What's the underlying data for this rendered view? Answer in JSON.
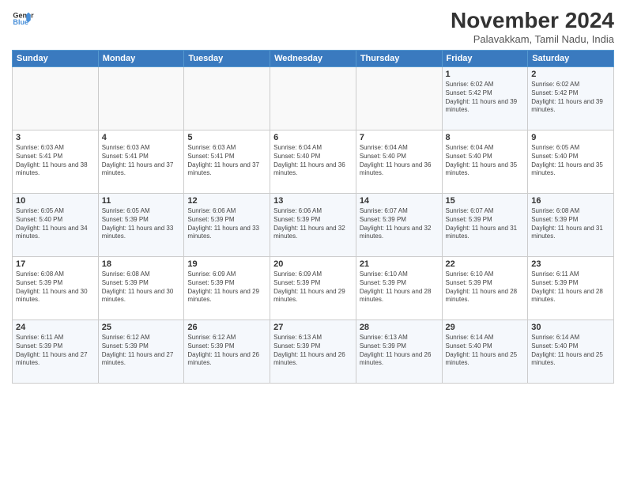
{
  "logo": {
    "line1": "General",
    "line2": "Blue"
  },
  "title": "November 2024",
  "subtitle": "Palavakkam, Tamil Nadu, India",
  "days_header": [
    "Sunday",
    "Monday",
    "Tuesday",
    "Wednesday",
    "Thursday",
    "Friday",
    "Saturday"
  ],
  "weeks": [
    [
      {
        "num": "",
        "info": ""
      },
      {
        "num": "",
        "info": ""
      },
      {
        "num": "",
        "info": ""
      },
      {
        "num": "",
        "info": ""
      },
      {
        "num": "",
        "info": ""
      },
      {
        "num": "1",
        "info": "Sunrise: 6:02 AM\nSunset: 5:42 PM\nDaylight: 11 hours and 39 minutes."
      },
      {
        "num": "2",
        "info": "Sunrise: 6:02 AM\nSunset: 5:42 PM\nDaylight: 11 hours and 39 minutes."
      }
    ],
    [
      {
        "num": "3",
        "info": "Sunrise: 6:03 AM\nSunset: 5:41 PM\nDaylight: 11 hours and 38 minutes."
      },
      {
        "num": "4",
        "info": "Sunrise: 6:03 AM\nSunset: 5:41 PM\nDaylight: 11 hours and 37 minutes."
      },
      {
        "num": "5",
        "info": "Sunrise: 6:03 AM\nSunset: 5:41 PM\nDaylight: 11 hours and 37 minutes."
      },
      {
        "num": "6",
        "info": "Sunrise: 6:04 AM\nSunset: 5:40 PM\nDaylight: 11 hours and 36 minutes."
      },
      {
        "num": "7",
        "info": "Sunrise: 6:04 AM\nSunset: 5:40 PM\nDaylight: 11 hours and 36 minutes."
      },
      {
        "num": "8",
        "info": "Sunrise: 6:04 AM\nSunset: 5:40 PM\nDaylight: 11 hours and 35 minutes."
      },
      {
        "num": "9",
        "info": "Sunrise: 6:05 AM\nSunset: 5:40 PM\nDaylight: 11 hours and 35 minutes."
      }
    ],
    [
      {
        "num": "10",
        "info": "Sunrise: 6:05 AM\nSunset: 5:40 PM\nDaylight: 11 hours and 34 minutes."
      },
      {
        "num": "11",
        "info": "Sunrise: 6:05 AM\nSunset: 5:39 PM\nDaylight: 11 hours and 33 minutes."
      },
      {
        "num": "12",
        "info": "Sunrise: 6:06 AM\nSunset: 5:39 PM\nDaylight: 11 hours and 33 minutes."
      },
      {
        "num": "13",
        "info": "Sunrise: 6:06 AM\nSunset: 5:39 PM\nDaylight: 11 hours and 32 minutes."
      },
      {
        "num": "14",
        "info": "Sunrise: 6:07 AM\nSunset: 5:39 PM\nDaylight: 11 hours and 32 minutes."
      },
      {
        "num": "15",
        "info": "Sunrise: 6:07 AM\nSunset: 5:39 PM\nDaylight: 11 hours and 31 minutes."
      },
      {
        "num": "16",
        "info": "Sunrise: 6:08 AM\nSunset: 5:39 PM\nDaylight: 11 hours and 31 minutes."
      }
    ],
    [
      {
        "num": "17",
        "info": "Sunrise: 6:08 AM\nSunset: 5:39 PM\nDaylight: 11 hours and 30 minutes."
      },
      {
        "num": "18",
        "info": "Sunrise: 6:08 AM\nSunset: 5:39 PM\nDaylight: 11 hours and 30 minutes."
      },
      {
        "num": "19",
        "info": "Sunrise: 6:09 AM\nSunset: 5:39 PM\nDaylight: 11 hours and 29 minutes."
      },
      {
        "num": "20",
        "info": "Sunrise: 6:09 AM\nSunset: 5:39 PM\nDaylight: 11 hours and 29 minutes."
      },
      {
        "num": "21",
        "info": "Sunrise: 6:10 AM\nSunset: 5:39 PM\nDaylight: 11 hours and 28 minutes."
      },
      {
        "num": "22",
        "info": "Sunrise: 6:10 AM\nSunset: 5:39 PM\nDaylight: 11 hours and 28 minutes."
      },
      {
        "num": "23",
        "info": "Sunrise: 6:11 AM\nSunset: 5:39 PM\nDaylight: 11 hours and 28 minutes."
      }
    ],
    [
      {
        "num": "24",
        "info": "Sunrise: 6:11 AM\nSunset: 5:39 PM\nDaylight: 11 hours and 27 minutes."
      },
      {
        "num": "25",
        "info": "Sunrise: 6:12 AM\nSunset: 5:39 PM\nDaylight: 11 hours and 27 minutes."
      },
      {
        "num": "26",
        "info": "Sunrise: 6:12 AM\nSunset: 5:39 PM\nDaylight: 11 hours and 26 minutes."
      },
      {
        "num": "27",
        "info": "Sunrise: 6:13 AM\nSunset: 5:39 PM\nDaylight: 11 hours and 26 minutes."
      },
      {
        "num": "28",
        "info": "Sunrise: 6:13 AM\nSunset: 5:39 PM\nDaylight: 11 hours and 26 minutes."
      },
      {
        "num": "29",
        "info": "Sunrise: 6:14 AM\nSunset: 5:40 PM\nDaylight: 11 hours and 25 minutes."
      },
      {
        "num": "30",
        "info": "Sunrise: 6:14 AM\nSunset: 5:40 PM\nDaylight: 11 hours and 25 minutes."
      }
    ]
  ]
}
